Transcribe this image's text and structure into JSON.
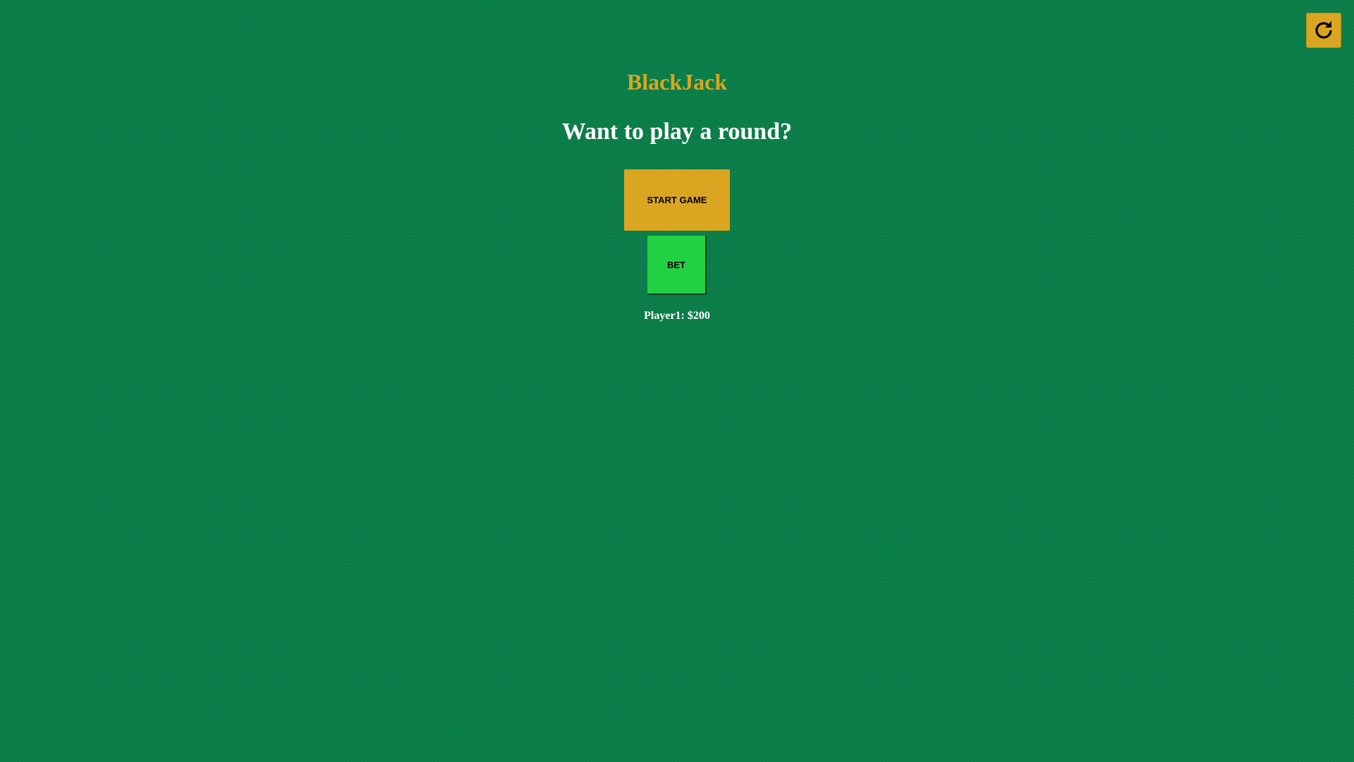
{
  "app": {
    "title": "BlackJack",
    "prompt": "Want to play a round?"
  },
  "controls": {
    "reset_icon": "refresh-icon",
    "start_label": "START GAME",
    "bet_label": "BET"
  },
  "player": {
    "balance_text": "Player1: $200"
  },
  "colors": {
    "felt": "#0b7f4a",
    "gold": "#daa520",
    "bet_green": "#22d143",
    "text_white": "#ffffff"
  }
}
